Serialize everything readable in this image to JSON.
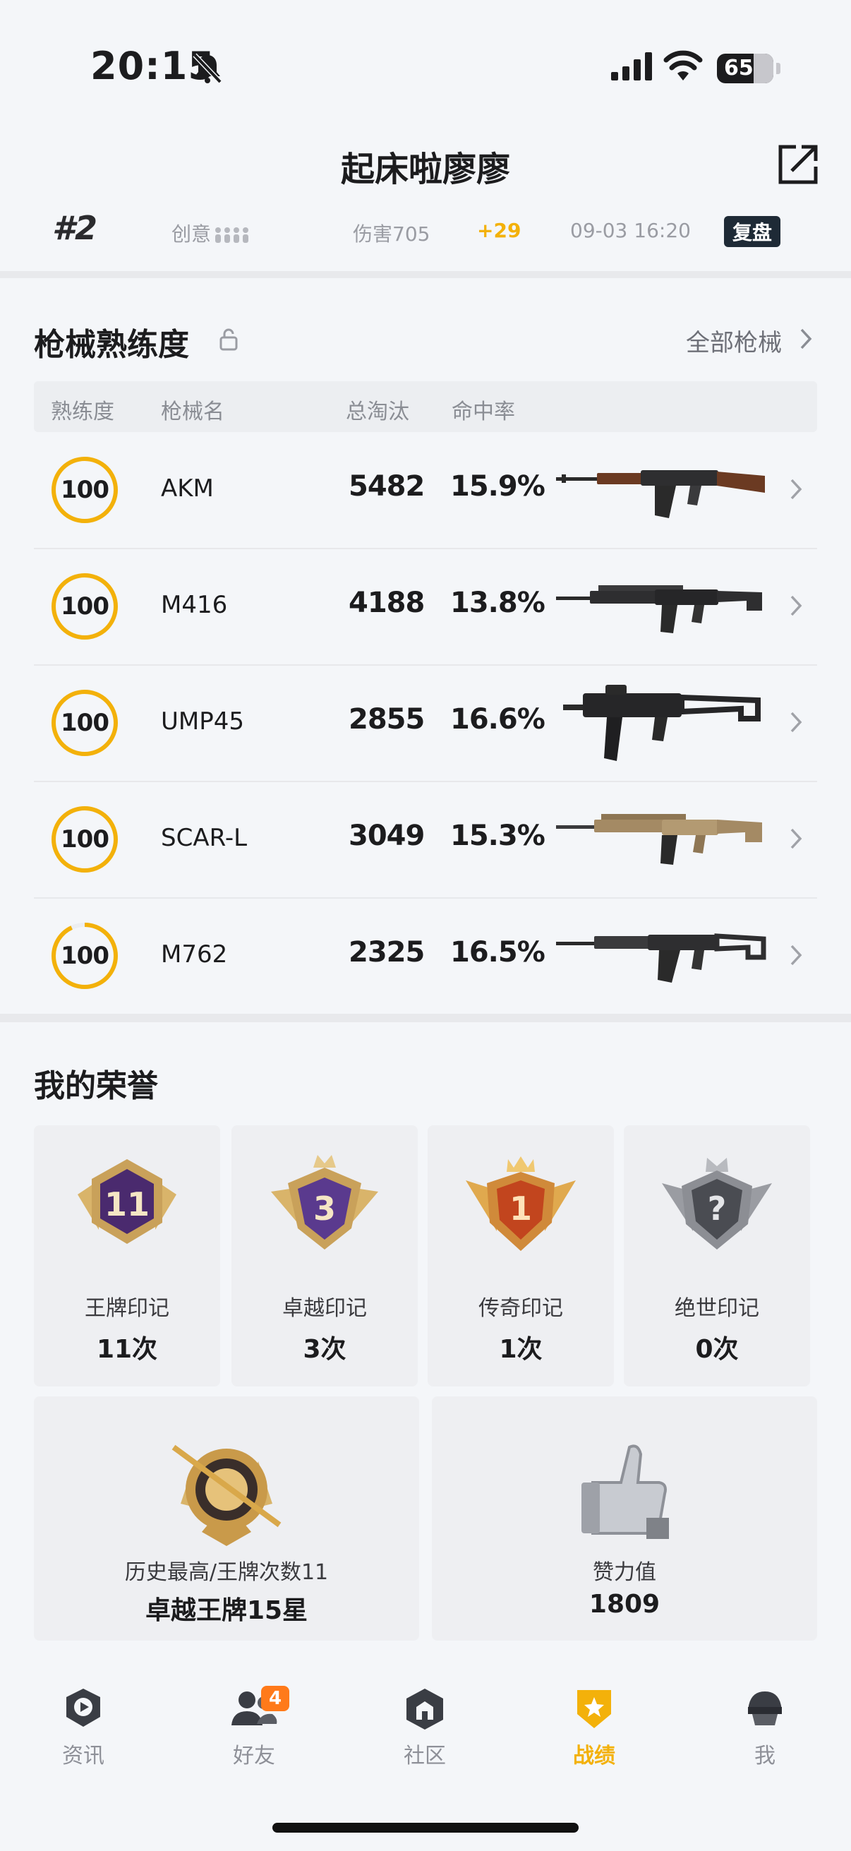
{
  "status_bar": {
    "time": "20:15",
    "battery": "65"
  },
  "header": {
    "title": "起床啦廖廖"
  },
  "match_row": {
    "rank": "#2",
    "mode": "创意",
    "damage": "伤害705",
    "delta": "+29",
    "datetime": "09-03 16:20",
    "review_label": "复盘"
  },
  "weapons_section": {
    "title": "枪械熟练度",
    "all_link": "全部枪械",
    "columns": [
      "熟练度",
      "枪械名",
      "总淘汰",
      "命中率"
    ],
    "rows": [
      {
        "proficiency": "100",
        "name": "AKM",
        "kills": "5482",
        "accuracy": "15.9%",
        "ring_fill": 1.0
      },
      {
        "proficiency": "100",
        "name": "M416",
        "kills": "4188",
        "accuracy": "13.8%",
        "ring_fill": 1.0
      },
      {
        "proficiency": "100",
        "name": "UMP45",
        "kills": "2855",
        "accuracy": "16.6%",
        "ring_fill": 1.0
      },
      {
        "proficiency": "100",
        "name": "SCAR-L",
        "kills": "3049",
        "accuracy": "15.3%",
        "ring_fill": 1.0
      },
      {
        "proficiency": "100",
        "name": "M762",
        "kills": "2325",
        "accuracy": "16.5%",
        "ring_fill": 0.93
      }
    ]
  },
  "honors": {
    "title": "我的荣誉",
    "cards": [
      {
        "name": "王牌印记",
        "count": "11次",
        "badge_text": "11"
      },
      {
        "name": "卓越印记",
        "count": "3次",
        "badge_text": "3"
      },
      {
        "name": "传奇印记",
        "count": "1次",
        "badge_text": "1"
      },
      {
        "name": "绝世印记",
        "count": "0次",
        "badge_text": "?"
      }
    ],
    "best": {
      "label": "历史最高/王牌次数11",
      "value": "卓越王牌15星"
    },
    "likes": {
      "label": "赞力值",
      "value": "1809"
    }
  },
  "tab_bar": {
    "tabs": [
      {
        "label": "资讯",
        "icon": "news-icon"
      },
      {
        "label": "好友",
        "icon": "friends-icon",
        "badge": "4"
      },
      {
        "label": "社区",
        "icon": "community-icon"
      },
      {
        "label": "战绩",
        "icon": "record-icon",
        "active": true
      },
      {
        "label": "我",
        "icon": "profile-icon"
      }
    ]
  },
  "colors": {
    "accent": "#f3b10a",
    "badge": "#ff7a1a",
    "background": "#f4f6f9"
  }
}
